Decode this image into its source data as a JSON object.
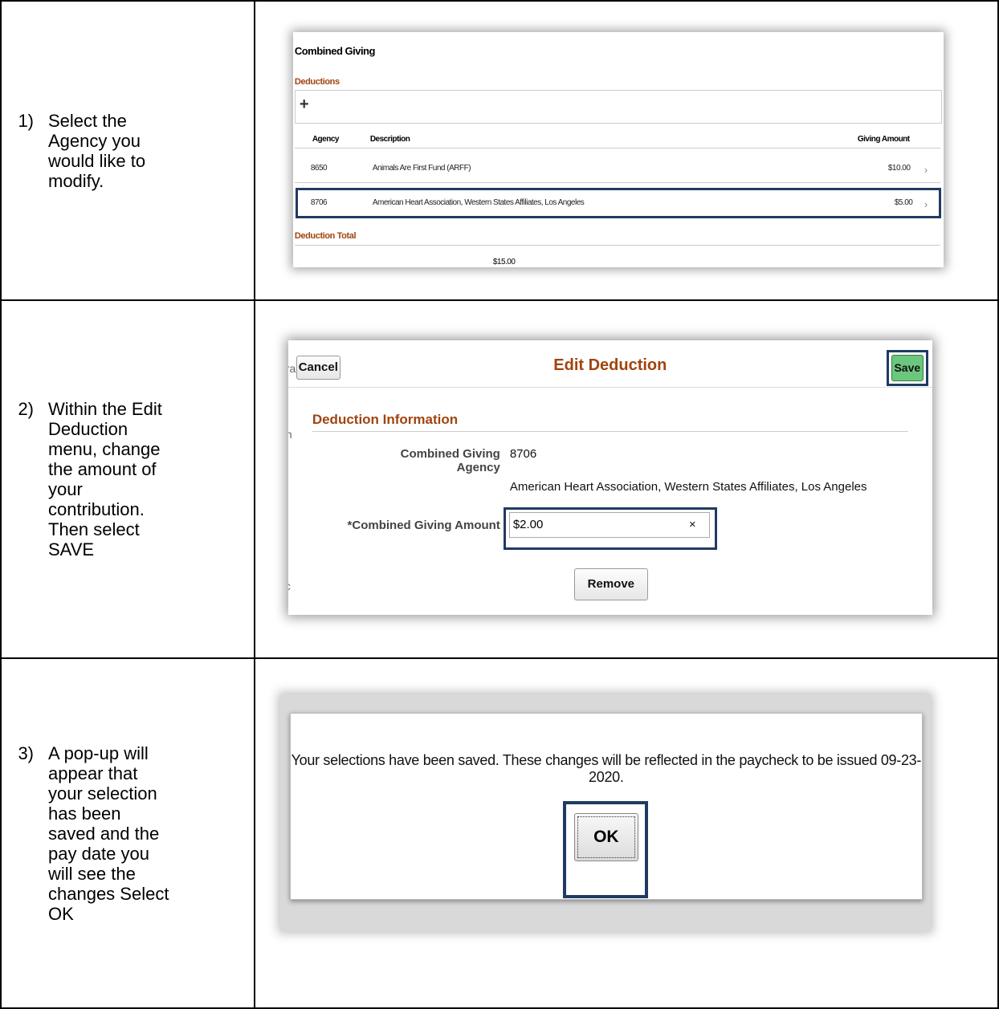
{
  "steps": [
    {
      "number": "1)",
      "lines": [
        "Select the",
        "Agency you",
        "would like to",
        "modify."
      ]
    },
    {
      "number": "2)",
      "lines": [
        "Within the Edit",
        "Deduction",
        "menu, change",
        "the amount of",
        "your",
        "contribution.",
        "Then select",
        "SAVE"
      ]
    },
    {
      "number": "3)",
      "lines": [
        "A pop-up will",
        "appear that",
        "your selection",
        "has been",
        "saved and the",
        "pay date you",
        "will see the",
        "changes Select",
        "OK"
      ]
    }
  ],
  "screen1": {
    "title": "Combined Giving",
    "section": "Deductions",
    "add_icon": "plus-icon",
    "columns": {
      "agency": "Agency",
      "description": "Description",
      "amount": "Giving Amount"
    },
    "rows": [
      {
        "agency": "8650",
        "description": "Animals Are First Fund (ARFF)",
        "amount": "$10.00"
      },
      {
        "agency": "8706",
        "description": "American Heart Association, Western States Affiliates, Los Angeles",
        "amount": "$5.00"
      }
    ],
    "total_label": "Deduction Total",
    "total_value": "$15.00"
  },
  "screen2": {
    "cancel": "Cancel",
    "title": "Edit Deduction",
    "save": "Save",
    "section": "Deduction Information",
    "agency_label": "Combined Giving Agency",
    "agency_value": "8706",
    "agency_desc": "American Heart Association, Western States Affiliates, Los Angeles",
    "amount_label": "*Combined Giving Amount",
    "amount_value": "$2.00",
    "clear": "×",
    "remove": "Remove",
    "ghost_left_top": "ra",
    "ghost_left_mid": "n",
    "ghost_left_bot": "c"
  },
  "screen3": {
    "message": "Your selections have been saved.  These changes will be reflected in the paycheck to be issued 09-23-2020.",
    "ok": "OK"
  },
  "colors": {
    "highlight": "#1f3b63",
    "label_orange": "#a0440e",
    "save_green": "#6cc67e"
  }
}
